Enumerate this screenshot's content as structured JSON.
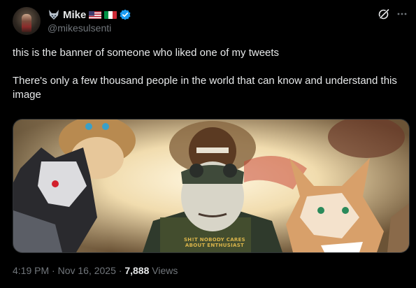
{
  "author": {
    "display_name": "Mike",
    "handle": "@mikesulsenti"
  },
  "icons": [
    "fox-emoji",
    "us-flag",
    "italy-flag",
    "verified-badge",
    "grok-icon",
    "more-icon"
  ],
  "colors": {
    "background": "#000000",
    "text": "#e7e9ea",
    "secondary": "#71767b",
    "verified": "#1d9bf0"
  },
  "tweet": {
    "line1": "this is the banner of someone who liked one of my tweets",
    "line2": "There's only a few thousand people in the world that can know and understand this image"
  },
  "media": {
    "caption": "SH!T NOBODY CARES ABOUT ENTHUSIAST"
  },
  "meta": {
    "time": "4:19 PM",
    "separator": "·",
    "date": "Nov 16, 2025",
    "views_count": "7,888",
    "views_label": "Views"
  }
}
